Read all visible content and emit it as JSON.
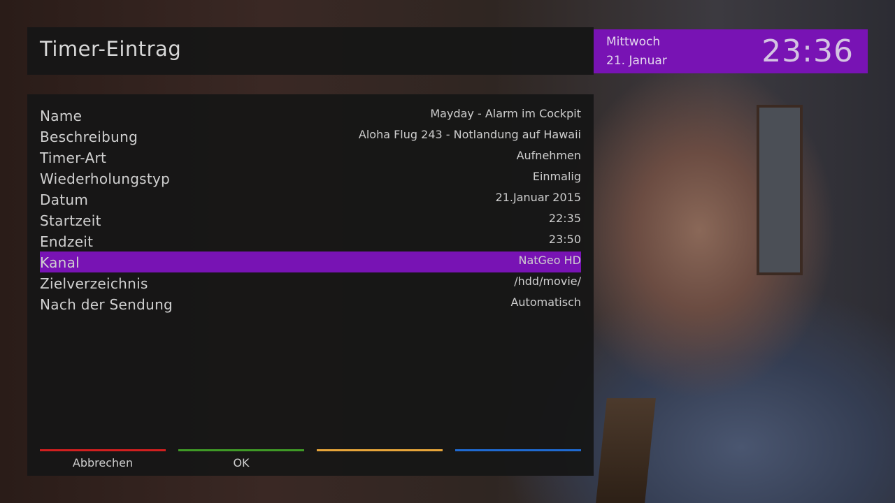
{
  "header": {
    "title": "Timer-Eintrag"
  },
  "clock": {
    "day": "Mittwoch",
    "date": "21. Januar",
    "time": "23:36"
  },
  "entries": [
    {
      "label": "Name",
      "value": "Mayday - Alarm im Cockpit"
    },
    {
      "label": "Beschreibung",
      "value": "Aloha Flug 243 - Notlandung auf Hawaii"
    },
    {
      "label": "Timer-Art",
      "value": "Aufnehmen"
    },
    {
      "label": "Wiederholungstyp",
      "value": "Einmalig"
    },
    {
      "label": "Datum",
      "value": "21.Januar 2015"
    },
    {
      "label": "Startzeit",
      "value": "22:35"
    },
    {
      "label": "Endzeit",
      "value": "23:50"
    },
    {
      "label": "Kanal",
      "value": "NatGeo HD"
    },
    {
      "label": "Zielverzeichnis",
      "value": "/hdd/movie/"
    },
    {
      "label": "Nach der Sendung",
      "value": "Automatisch"
    }
  ],
  "selected_index": 7,
  "buttons": {
    "red": {
      "label": "Abbrechen",
      "color": "#d11f1f"
    },
    "green": {
      "label": "OK",
      "color": "#3f9a26"
    },
    "yellow": {
      "label": "",
      "color": "#e7a53a"
    },
    "blue": {
      "label": "",
      "color": "#1f6ad1"
    }
  },
  "colors": {
    "accent": "#7813b4",
    "panel": "#161616",
    "text": "#d0d0d0"
  }
}
